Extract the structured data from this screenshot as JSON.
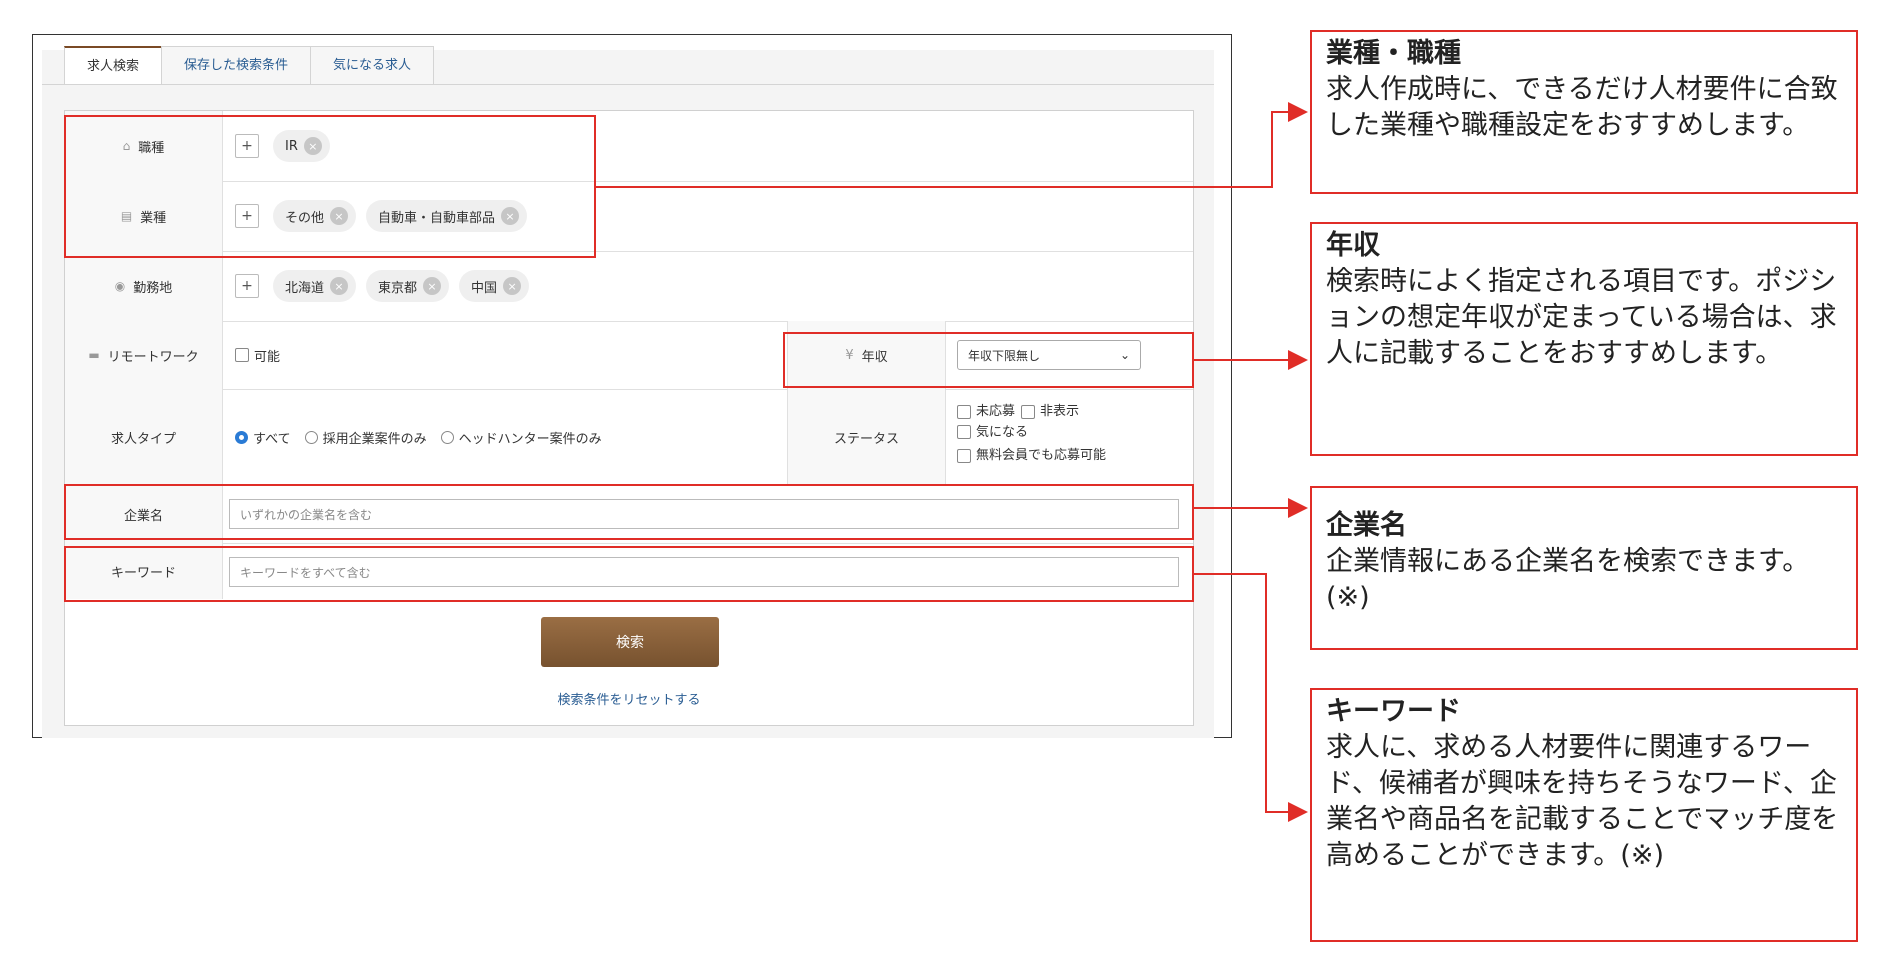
{
  "tabs": [
    "求人検索",
    "保存した検索条件",
    "気になる求人"
  ],
  "rows": {
    "occupation": {
      "label": "職種",
      "chips": [
        "IR"
      ]
    },
    "industry": {
      "label": "業種",
      "chips": [
        "その他",
        "自動車・自動車部品"
      ]
    },
    "location": {
      "label": "勤務地",
      "chips": [
        "北海道",
        "東京都",
        "中国"
      ]
    },
    "remote": {
      "label": "リモートワーク",
      "option": "可能"
    },
    "salary": {
      "label": "年収",
      "select_value": "年収下限無し"
    },
    "job_type": {
      "label": "求人タイプ",
      "options": [
        "すべて",
        "採用企業案件のみ",
        "ヘッドハンター案件のみ"
      ],
      "selected": "すべて"
    },
    "status": {
      "label": "ステータス",
      "options": [
        "未応募",
        "非表示",
        "気になる",
        "無料会員でも応募可能"
      ]
    },
    "company": {
      "label": "企業名",
      "placeholder": "いずれかの企業名を含む"
    },
    "keyword": {
      "label": "キーワード",
      "placeholder": "キーワードをすべて含む"
    }
  },
  "search_button": "検索",
  "reset_link": "検索条件をリセットする",
  "callouts": [
    {
      "title": "業種・職種",
      "body": "求人作成時に、できるだけ人材要件に合致した業種や職種設定をおすすめします。"
    },
    {
      "title": "年収",
      "body": "検索時によく指定される項目です。ポジションの想定年収が定まっている場合は、求人に記載することをおすすめします。"
    },
    {
      "title": "企業名",
      "body": "企業情報にある企業名を検索できます。(※)"
    },
    {
      "title": "キーワード",
      "body": "求人に、求める人材要件に関連するワード、候補者が興味を持ちそうなワード、企業名や商品名を記載することでマッチ度を高めることができます。(※)"
    }
  ],
  "colors": {
    "accent_red": "#e02d27",
    "brand_brown": "#7a4a25",
    "link_blue": "#2a5d93"
  }
}
